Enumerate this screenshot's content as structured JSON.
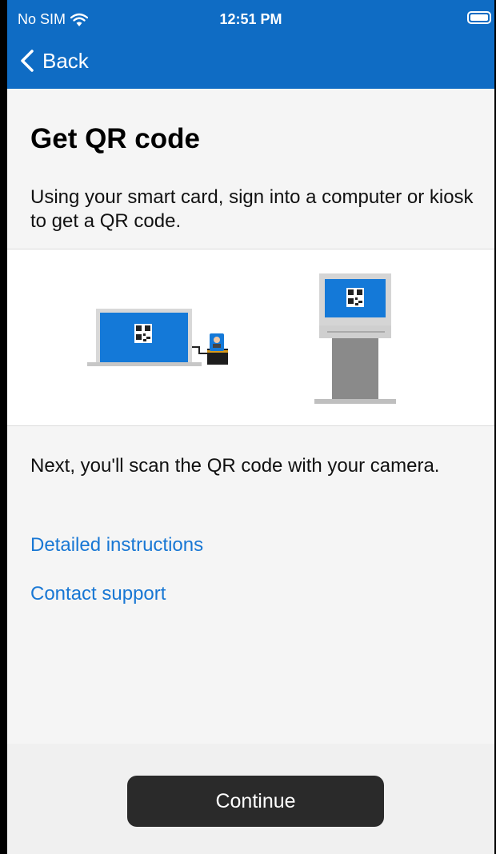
{
  "status_bar": {
    "carrier": "No SIM",
    "time": "12:51 PM",
    "wifi_icon": "wifi-icon",
    "battery_icon": "battery-icon"
  },
  "nav": {
    "back_label": "Back",
    "back_icon": "chevron-left-icon"
  },
  "page": {
    "title": "Get QR code",
    "intro": "Using your smart card, sign into a computer or kiosk to get a QR code.",
    "next_text": "Next, you'll scan the QR code with your camera.",
    "links": {
      "detailed_instructions": "Detailed instructions",
      "contact_support": "Contact support"
    }
  },
  "illustration": {
    "items": [
      "laptop-with-qr-code",
      "smart-card-reader",
      "kiosk-with-qr-code"
    ]
  },
  "footer": {
    "continue_label": "Continue"
  },
  "colors": {
    "header_bg": "#0f6cc4",
    "link": "#1877d4",
    "button_bg": "#2a2a2a",
    "page_bg": "#f5f5f5"
  }
}
